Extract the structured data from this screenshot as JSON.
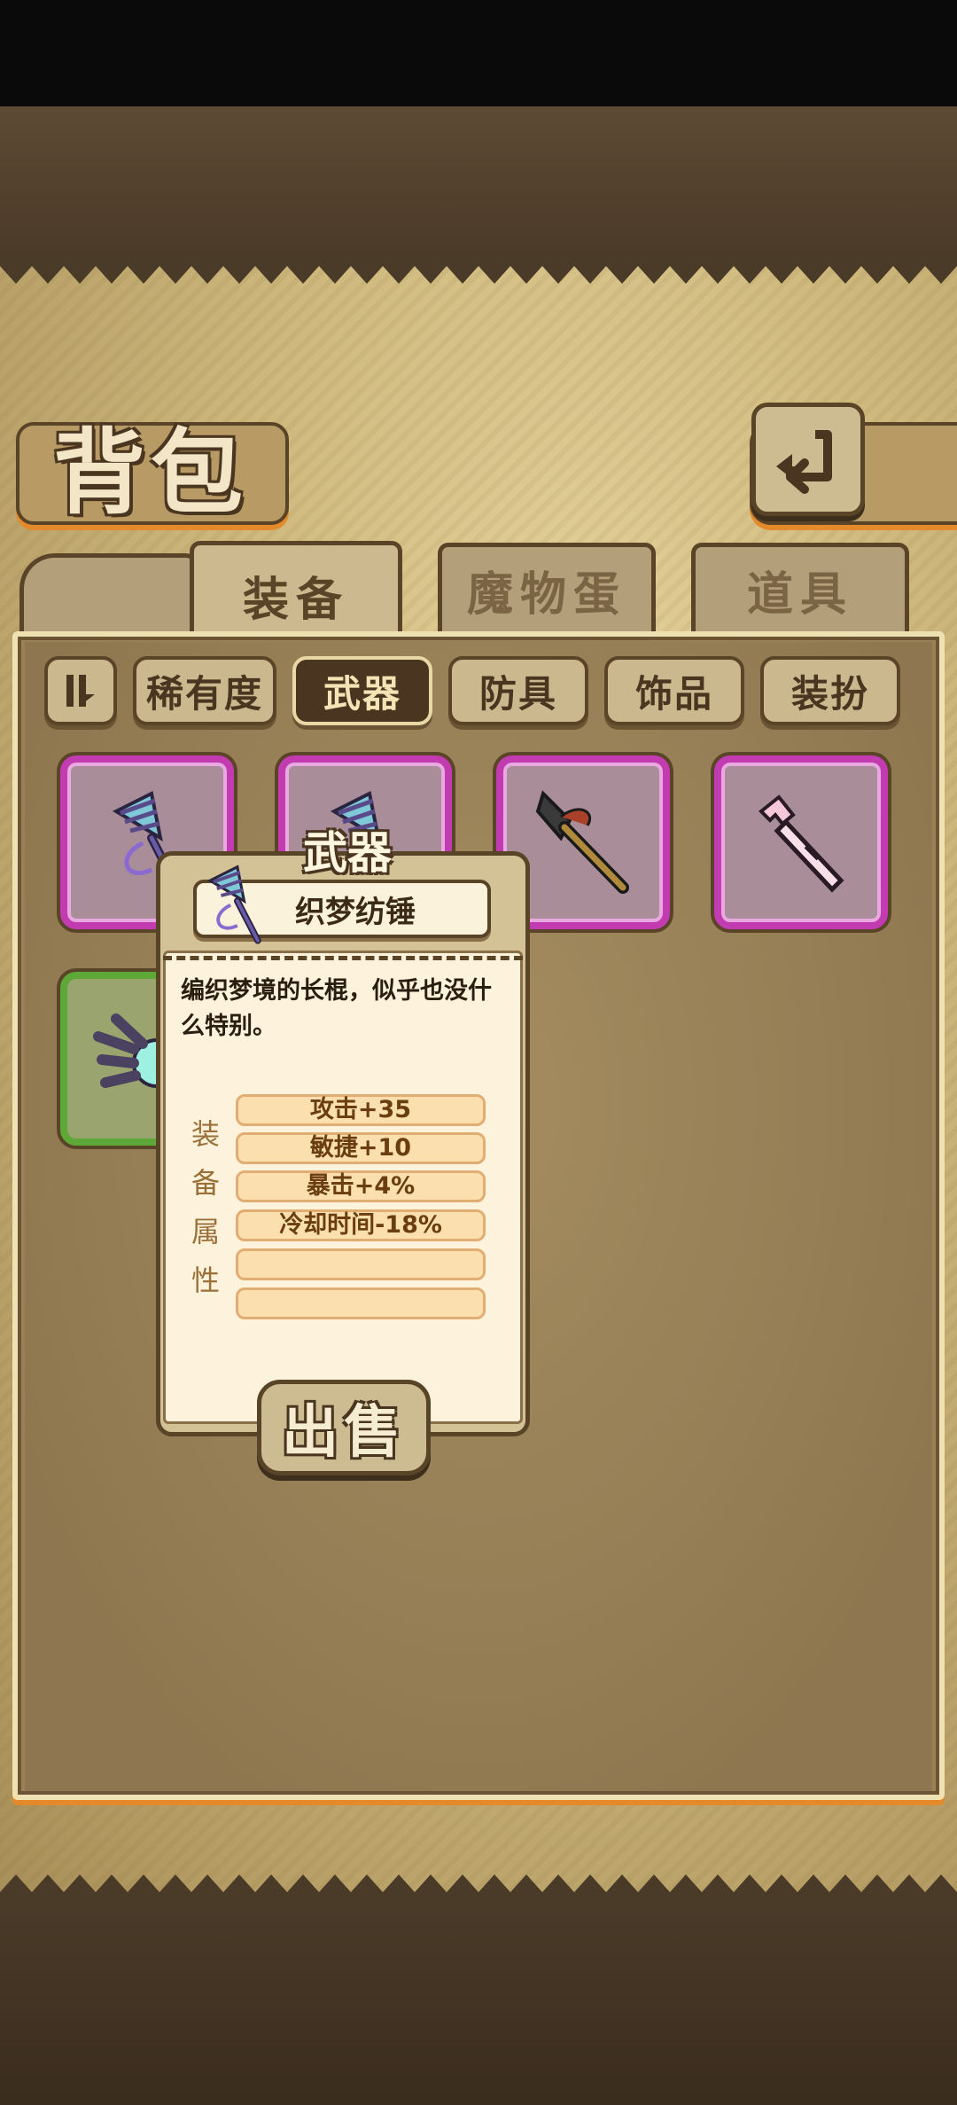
{
  "page": {
    "title": "背包"
  },
  "tabs": [
    {
      "label": "装备",
      "active": true
    },
    {
      "label": "魔物蛋",
      "active": false
    },
    {
      "label": "道具",
      "active": false
    }
  ],
  "filters": {
    "sort_icon": "pause-sort-icon",
    "items": [
      "稀有度",
      "武器",
      "防具",
      "饰品",
      "装扮"
    ],
    "selected": "武器"
  },
  "slots": [
    {
      "icon": "dream-spindle-icon",
      "rarity_color": "#c23bb0"
    },
    {
      "icon": "dream-spindle-icon",
      "rarity_color": "#c23bb0"
    },
    {
      "icon": "dark-spear-icon",
      "rarity_color": "#c23bb0"
    },
    {
      "icon": "pink-tool-icon",
      "rarity_color": "#c23bb0"
    },
    {
      "icon": "claw-glove-icon",
      "rarity_color": "#5da836"
    }
  ],
  "popup": {
    "header": "武器",
    "item_name": "织梦纺锤",
    "item_icon": "dream-spindle-icon",
    "description": "编织梦境的长棍，似乎也没什么特别。",
    "attr_label": [
      "装",
      "备",
      "属",
      "性"
    ],
    "stats": [
      "攻击+35",
      "敏捷+10",
      "暴击+4%",
      "冷却时间-18%",
      "",
      ""
    ],
    "sell_label": "出售"
  },
  "colors": {
    "accent": "#e48a2a",
    "purple_rarity": "#c23bb0",
    "green_rarity": "#5da836",
    "frame": "#5a4428"
  }
}
